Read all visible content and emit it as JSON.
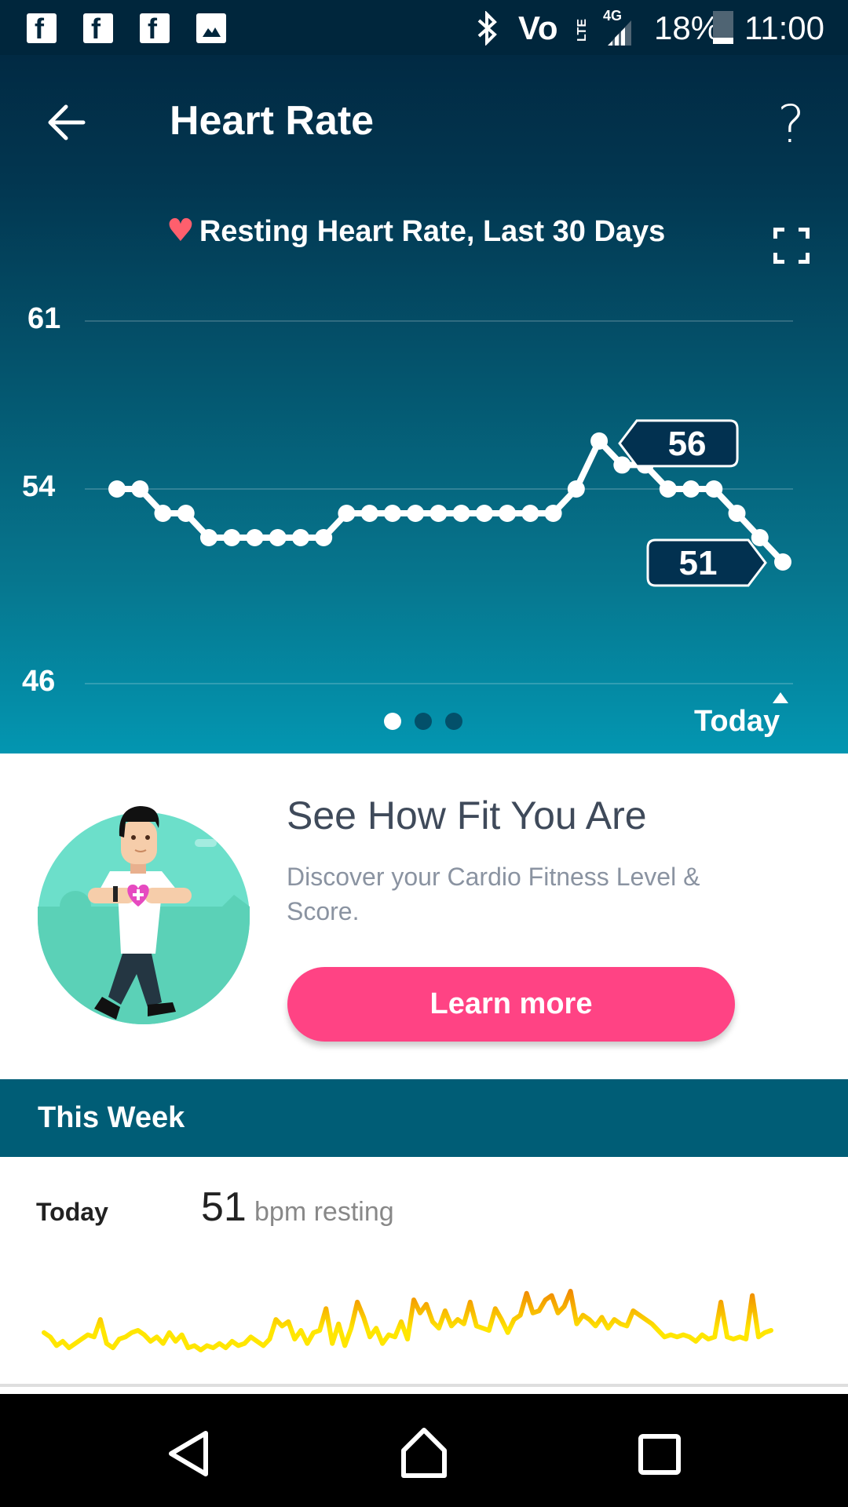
{
  "status_bar": {
    "notification_icons": [
      "facebook-icon",
      "facebook-icon",
      "facebook-icon",
      "image-icon"
    ],
    "system_icons": [
      "bluetooth-icon",
      "volte-icon",
      "lte-icon",
      "signal-4g-icon"
    ],
    "network_label": "4G",
    "volte_label": "Vo",
    "lte_label": "LTE",
    "battery": "18%",
    "time": "11:00"
  },
  "header": {
    "title": "Heart Rate",
    "back_icon": "arrow-left-icon",
    "help_label": "?"
  },
  "chart_header": {
    "heart_glyph": "♥",
    "title": "Resting Heart Rate, Last 30 Days"
  },
  "chart_data": {
    "type": "line",
    "title": "Resting Heart Rate, Last 30 Days",
    "xlabel": "",
    "ylabel": "",
    "x_end_label": "Today",
    "y_ticks": [
      61,
      54,
      46
    ],
    "ylim": [
      46,
      61
    ],
    "grid": true,
    "series": [
      {
        "name": "Resting Heart Rate",
        "values": [
          54,
          54,
          53,
          53,
          52,
          52,
          52,
          52,
          52,
          52,
          53,
          53,
          53,
          53,
          53,
          53,
          53,
          53,
          53,
          53,
          54,
          56,
          55,
          55,
          54,
          54,
          54,
          53,
          52,
          51
        ]
      }
    ],
    "annotations": [
      {
        "label": "56",
        "index": 21,
        "kind": "max"
      },
      {
        "label": "51",
        "index": 29,
        "kind": "latest"
      }
    ]
  },
  "pager": {
    "count": 3,
    "active": 0
  },
  "today_label": "Today",
  "promo_card": {
    "title": "See How Fit You Are",
    "description": "Discover your Cardio Fitness Level & Score.",
    "button_label": "Learn more",
    "accent": "#ff4384"
  },
  "this_week": {
    "section_title": "This Week",
    "rows": [
      {
        "day": "Today",
        "value": "51",
        "unit": "bpm resting"
      }
    ]
  },
  "intraday_sparkline": {
    "colors": {
      "low": "#ffe600",
      "high": "#f08a00"
    },
    "values": [
      52,
      50,
      46,
      48,
      45,
      47,
      49,
      51,
      50,
      58,
      47,
      45,
      49,
      50,
      52,
      53,
      51,
      48,
      50,
      47,
      52,
      48,
      51,
      45,
      46,
      44,
      46,
      45,
      47,
      45,
      48,
      46,
      47,
      50,
      48,
      46,
      49,
      58,
      55,
      57,
      49,
      53,
      47,
      52,
      53,
      63,
      47,
      56,
      46,
      54,
      66,
      59,
      50,
      54,
      47,
      51,
      50,
      57,
      49,
      67,
      61,
      65,
      57,
      54,
      62,
      55,
      58,
      56,
      66,
      55,
      54,
      53,
      63,
      58,
      52,
      58,
      60,
      70,
      61,
      62,
      67,
      69,
      61,
      64,
      71,
      56,
      60,
      58,
      55,
      59,
      54,
      58,
      56,
      55,
      62,
      60,
      58,
      56,
      53,
      50,
      51,
      50,
      51,
      50,
      48,
      51,
      49,
      50,
      66,
      50,
      49,
      50,
      49,
      69,
      50,
      52,
      53
    ]
  },
  "nav_bar": {
    "buttons": [
      "back-nav-icon",
      "home-nav-icon",
      "recents-nav-icon"
    ]
  },
  "colors": {
    "status_bar": "#00263c",
    "hero_top": "#012a43",
    "hero_bottom": "#0396b1",
    "section_bar": "#005d76",
    "heart": "#ff5f6d",
    "badge_bg": "#023150"
  }
}
